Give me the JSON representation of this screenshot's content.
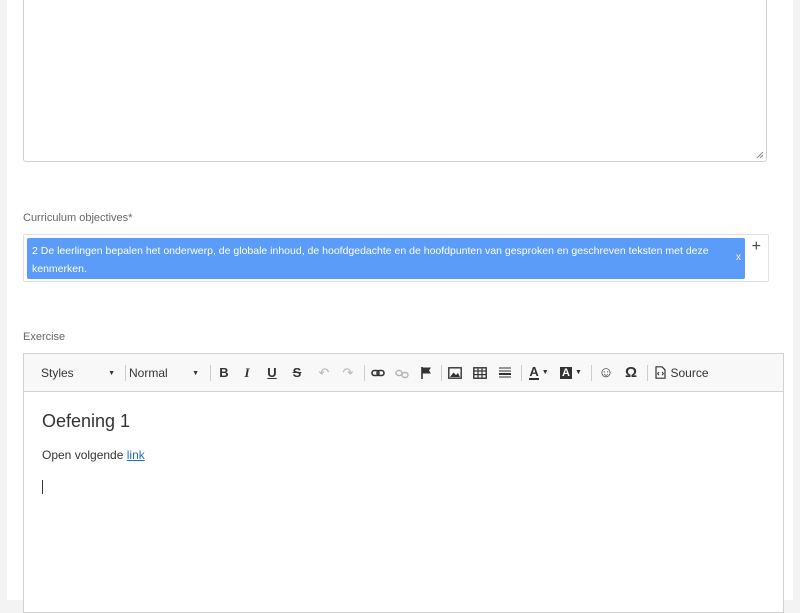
{
  "objectives": {
    "label": "Curriculum objectives*",
    "tag_text": "2 De leerlingen bepalen het onderwerp, de globale inhoud, de hoofdgedachte en de hoofdpunten van gesproken en geschreven teksten met deze kenmerken.",
    "tag_remove": "x",
    "add_symbol": "+"
  },
  "exercise": {
    "label": "Exercise",
    "toolbar": {
      "styles": "Styles",
      "format": "Normal",
      "bold": "B",
      "italic": "I",
      "underline": "U",
      "strike": "S",
      "undo": "↶",
      "redo": "↷",
      "link": "🔗",
      "unlink": "⛓",
      "anchor": "⚑",
      "image": "🖼",
      "table": "▦",
      "hline": "☰",
      "text_color": "A",
      "bg_color": "A",
      "smiley": "☺",
      "special_char": "Ω",
      "source": "Source"
    },
    "content": {
      "heading": "Oefening 1",
      "paragraph_text": "Open volgende ",
      "link_text": "link"
    }
  }
}
